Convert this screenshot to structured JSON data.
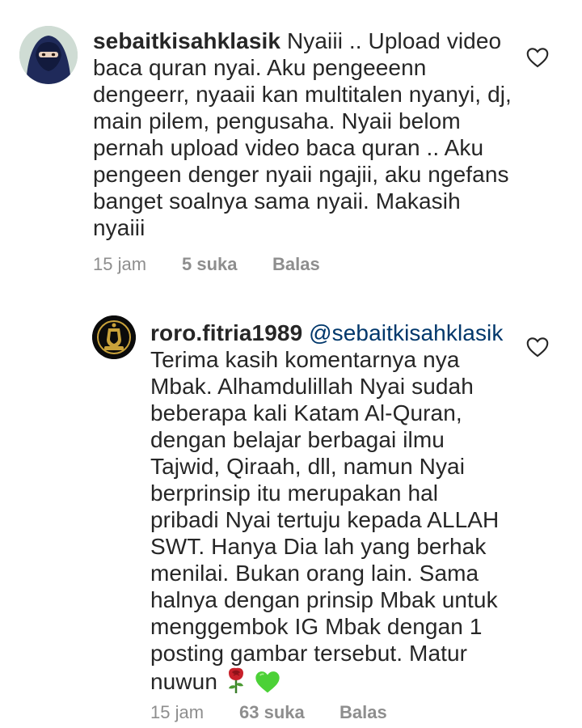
{
  "comments": [
    {
      "username": "sebaitkisahklasik",
      "mention": "",
      "lines": [
        "Nyaiii .. Upload video",
        "baca quran nyai. Aku pengeeenn",
        "dengeerr, nyaaii kan multitalen nyanyi, dj,",
        "main pilem, pengusaha. Nyaii belom",
        "pernah upload video baca quran .. Aku",
        "pengeen denger nyaii ngajii, aku ngefans",
        "banget soalnya sama nyaii. Makasih",
        "nyaiii"
      ],
      "time": "15 jam",
      "likes": "5 suka",
      "reply": "Balas",
      "avatar_icon": "niqab-avatar-icon"
    },
    {
      "username": "roro.fitria1989",
      "mention": "@sebaitkisahklasik",
      "lines": [
        "Terima kasih komentarnya nya",
        "Mbak.  Alhamdulillah Nyai sudah",
        "beberapa kali Katam Al-Quran,",
        "dengan belajar berbagai ilmu",
        "Tajwid,  Qiraah,  dll,  namun Nyai",
        "berprinsip itu merupakan hal",
        "pribadi Nyai tertuju kepada ALLAH",
        "SWT.  Hanya Dia lah yang berhak",
        "menilai. Bukan orang lain. Sama",
        "halnya dengan prinsip Mbak untuk",
        "menggembok IG Mbak dengan 1",
        "posting gambar tersebut. Matur",
        "nuwun"
      ],
      "time": "15 jam",
      "likes": "63 suka",
      "reply": "Balas",
      "avatar_icon": "gold-emblem-avatar-icon",
      "emojis": [
        "rose-icon",
        "green-heart-icon"
      ]
    }
  ],
  "colors": {
    "text": "#262626",
    "meta": "#8e8e8e",
    "mention": "#00376b",
    "green_heart": "#4cd137"
  }
}
